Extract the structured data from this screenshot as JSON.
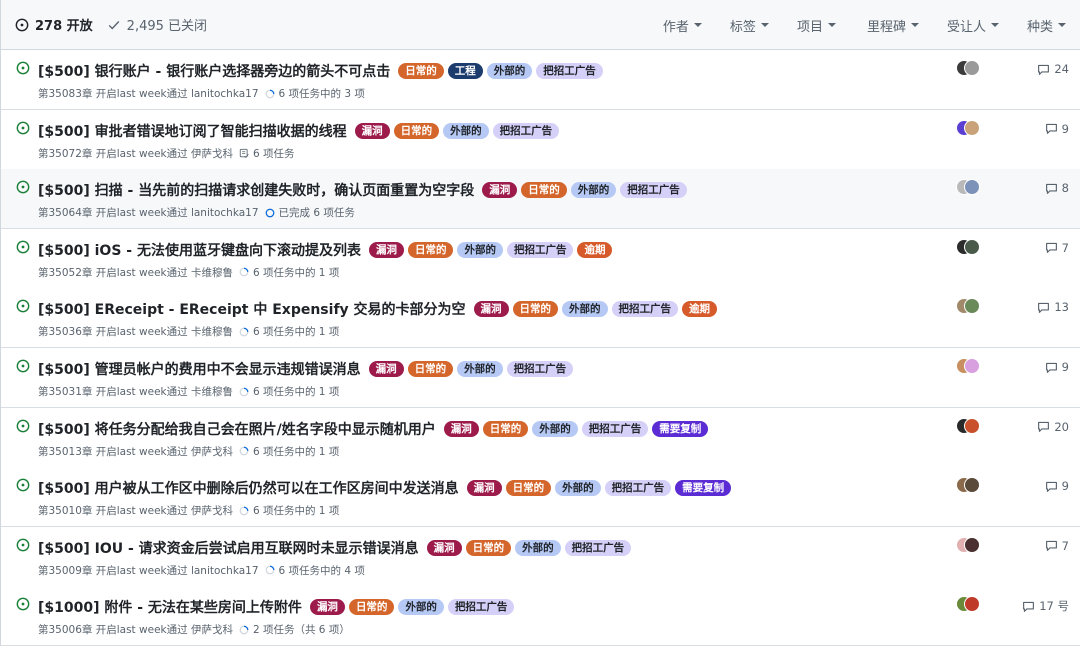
{
  "header": {
    "open_count": "278 开放",
    "closed_count": "2,495 已关闭",
    "filters": [
      "作者",
      "标签",
      "项目",
      "里程碑",
      "受让人",
      "种类"
    ]
  },
  "colors": {
    "open_icon": "#1a7f37",
    "日常的": "#d4662b",
    "工程": "#1d3c6e",
    "外部的": "#b6c9f5",
    "把招工广告": "#d4d0f7",
    "漏洞": "#9c1b4b",
    "逾期": "#d65a2a",
    "需要复制": "#5b2cd4"
  },
  "issues": [
    {
      "title": "[$500] 银行账户 - 银行账户选择器旁边的箭头不可点击",
      "labels": [
        "日常的",
        "工程",
        "外部的",
        "把招工广告"
      ],
      "meta": "第35083章 开启last week通过 lanitochka17",
      "task_icon": "progress-ring-icon",
      "task": "6 项任务中的 3 项",
      "comments": "24",
      "avatar": [
        "#3b3b3b",
        "#9a9a9a"
      ]
    },
    {
      "title": "[$500] 审批者错误地订阅了智能扫描收据的线程",
      "labels": [
        "漏洞",
        "日常的",
        "外部的",
        "把招工广告"
      ],
      "meta": "第35072章 开启last week通过 伊萨戈科",
      "task_icon": "checklist-icon",
      "task": "6 项任务",
      "comments": "9",
      "avatar": [
        "#5a3fd1",
        "#c9a27a"
      ]
    },
    {
      "title": "[$500] 扫描 - 当先前的扫描请求创建失败时，确认页面重置为空字段",
      "labels": [
        "漏洞",
        "日常的",
        "外部的",
        "把招工广告"
      ],
      "meta": "第35064章 开启last week通过 lanitochka17",
      "task_icon": "complete-ring-icon",
      "task": "已完成 6 项任务",
      "comments": "8",
      "avatar": [
        "#b9b9b9",
        "#7c92b8"
      ]
    },
    {
      "title": "[$500] iOS - 无法使用蓝牙键盘向下滚动提及列表",
      "labels": [
        "漏洞",
        "日常的",
        "外部的",
        "把招工广告",
        "逾期"
      ],
      "meta": "第35052章 开启last week通过 卡维穆鲁",
      "task_icon": "progress-ring-icon",
      "task": "6 项任务中的 1 项",
      "comments": "7",
      "avatar": [
        "#2c2c2c",
        "#4a5a4a"
      ]
    },
    {
      "title": "[$500] EReceipt - EReceipt 中 Expensify 交易的卡部分为空",
      "labels": [
        "漏洞",
        "日常的",
        "外部的",
        "把招工广告",
        "逾期"
      ],
      "meta": "第35036章 开启last week通过 卡维穆鲁",
      "task_icon": "progress-ring-icon",
      "task": "6 项任务中的 1 项",
      "comments": "13",
      "avatar": [
        "#a08a6a",
        "#6b8a5a"
      ]
    },
    {
      "title": "[$500] 管理员帐户的费用中不会显示违规错误消息",
      "labels": [
        "漏洞",
        "日常的",
        "外部的",
        "把招工广告"
      ],
      "meta": "第35031章 开启last week通过 卡维穆鲁",
      "task_icon": "progress-ring-icon",
      "task": "6 项任务中的 1 项",
      "comments": "9",
      "avatar": [
        "#c89060",
        "#d9a0e0"
      ]
    },
    {
      "title": "[$500] 将任务分配给我自己会在照片/姓名字段中显示随机用户",
      "labels": [
        "漏洞",
        "日常的",
        "外部的",
        "把招工广告",
        "需要复制"
      ],
      "meta": "第35013章 开启last week通过 伊萨戈科",
      "task_icon": "progress-ring-icon",
      "task": "6 项任务中的 1 项",
      "comments": "20",
      "avatar": [
        "#2a2a2a",
        "#c8502a"
      ]
    },
    {
      "title": "[$500] 用户被从工作区中删除后仍然可以在工作区房间中发送消息",
      "labels": [
        "漏洞",
        "日常的",
        "外部的",
        "把招工广告",
        "需要复制"
      ],
      "meta": "第35010章 开启last week通过 伊萨戈科",
      "task_icon": "progress-ring-icon",
      "task": "6 项任务中的 1 项",
      "comments": "9",
      "avatar": [
        "#8a6a4a",
        "#5a4a3a"
      ]
    },
    {
      "title": "[$500] IOU - 请求资金后尝试启用互联网时未显示错误消息",
      "labels": [
        "漏洞",
        "日常的",
        "外部的",
        "把招工广告"
      ],
      "meta": "第35009章 开启last week通过 lanitochka17",
      "task_icon": "progress-ring-icon",
      "task": "6 项任务中的 4 项",
      "comments": "7",
      "avatar": [
        "#e0b0b0",
        "#4a3030"
      ]
    },
    {
      "title": "[$1000] 附件 - 无法在某些房间上传附件",
      "labels": [
        "漏洞",
        "日常的",
        "外部的",
        "把招工广告"
      ],
      "meta": "第35006章 开启last week通过 伊萨戈科",
      "task_icon": "progress-ring-icon",
      "task": "2 项任务（共 6 项）",
      "comments": "17 号",
      "avatar": [
        "#6a8a3a",
        "#c03a2a"
      ]
    }
  ]
}
